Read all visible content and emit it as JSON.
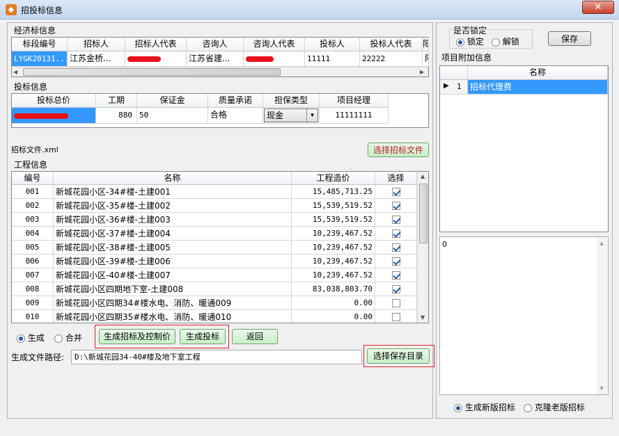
{
  "window": {
    "title": "招投标信息",
    "close": "✕"
  },
  "economic": {
    "label": "经济标信息",
    "headers": [
      "标段编号",
      "招标人",
      "招标人代表",
      "咨询人",
      "咨询人代表",
      "投标人",
      "投标人代表",
      "阳"
    ],
    "row": [
      "LYGK20131...",
      "江苏金桥...",
      "",
      "江苏省建...",
      "",
      "11111",
      "22222",
      "阳"
    ]
  },
  "bid": {
    "label": "投标信息",
    "headers": [
      "投标总价",
      "工期",
      "保证金",
      "质量承诺",
      "担保类型",
      "项目经理"
    ],
    "row": {
      "total": "",
      "period": "880",
      "deposit": "50",
      "quality": "合格",
      "guarantee": "现金",
      "manager": "11111111"
    }
  },
  "file": {
    "label": "招标文件.xml",
    "button": "选择招标文件"
  },
  "project": {
    "label": "工程信息",
    "headers": [
      "编号",
      "名称",
      "工程造价",
      "选择"
    ],
    "rows": [
      {
        "id": "001",
        "name": "新城花园小区-34#楼-土建001",
        "cost": "15,485,713.25",
        "checked": true
      },
      {
        "id": "002",
        "name": "新城花园小区-35#楼-土建002",
        "cost": "15,539,519.52",
        "checked": true
      },
      {
        "id": "003",
        "name": "新城花园小区-36#楼-土建003",
        "cost": "15,539,519.52",
        "checked": true
      },
      {
        "id": "004",
        "name": "新城花园小区-37#楼-土建004",
        "cost": "10,239,467.52",
        "checked": true
      },
      {
        "id": "005",
        "name": "新城花园小区-38#楼-土建005",
        "cost": "10,239,467.52",
        "checked": true
      },
      {
        "id": "006",
        "name": "新城花园小区-39#楼-土建006",
        "cost": "10,239,467.52",
        "checked": true
      },
      {
        "id": "007",
        "name": "新城花园小区-40#楼-土建007",
        "cost": "10,239,467.52",
        "checked": true
      },
      {
        "id": "008",
        "name": "新城花园小区四期地下室-土建008",
        "cost": "83,038,803.70",
        "checked": true
      },
      {
        "id": "009",
        "name": "新城花园小区四期34#楼水电、消防、暖通009",
        "cost": "0.00",
        "checked": false
      },
      {
        "id": "010",
        "name": "新城花园小区四期35#楼水电、消防、暖通010",
        "cost": "0.00",
        "checked": false
      }
    ]
  },
  "mode": {
    "generate": "生成",
    "merge": "合并"
  },
  "buttons": {
    "gen_tender": "生成招标及控制价",
    "gen_bid": "生成投标",
    "back": "返回",
    "choose_dir": "选择保存目录"
  },
  "output": {
    "label": "生成文件路径:",
    "value": "D:\\新城花园34-40#楼及地下室工程"
  },
  "lock": {
    "label": "是否锁定",
    "lock": "锁定",
    "unlock": "解锁",
    "save": "保存"
  },
  "extra": {
    "label": "项目附加信息",
    "header": "名称",
    "row_index": "1",
    "row_name": "招标代理费",
    "memo": "0"
  },
  "version": {
    "new": "生成新版招标",
    "old": "克隆老版招标"
  }
}
